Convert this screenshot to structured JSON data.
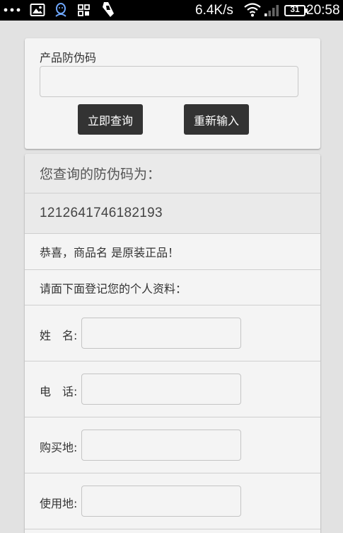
{
  "status_bar": {
    "dots_icon": "more-dots-icon",
    "net_speed": "6.4K/s",
    "battery_level": "31",
    "time": "20:58"
  },
  "query": {
    "label": "产品防伪码",
    "input_value": "",
    "submit_label": "立即查询",
    "reset_label": "重新输入"
  },
  "result": {
    "heading": "您查询的防伪码为：",
    "code": "1212641746182193",
    "message": "恭喜，商品名 是原装正品！",
    "register_prompt": "请面下面登记您的个人资料："
  },
  "form": {
    "fields": [
      {
        "label": "姓　名:",
        "value": ""
      },
      {
        "label": "电　话:",
        "value": ""
      },
      {
        "label": "购买地:",
        "value": ""
      },
      {
        "label": "使用地:",
        "value": ""
      }
    ]
  }
}
